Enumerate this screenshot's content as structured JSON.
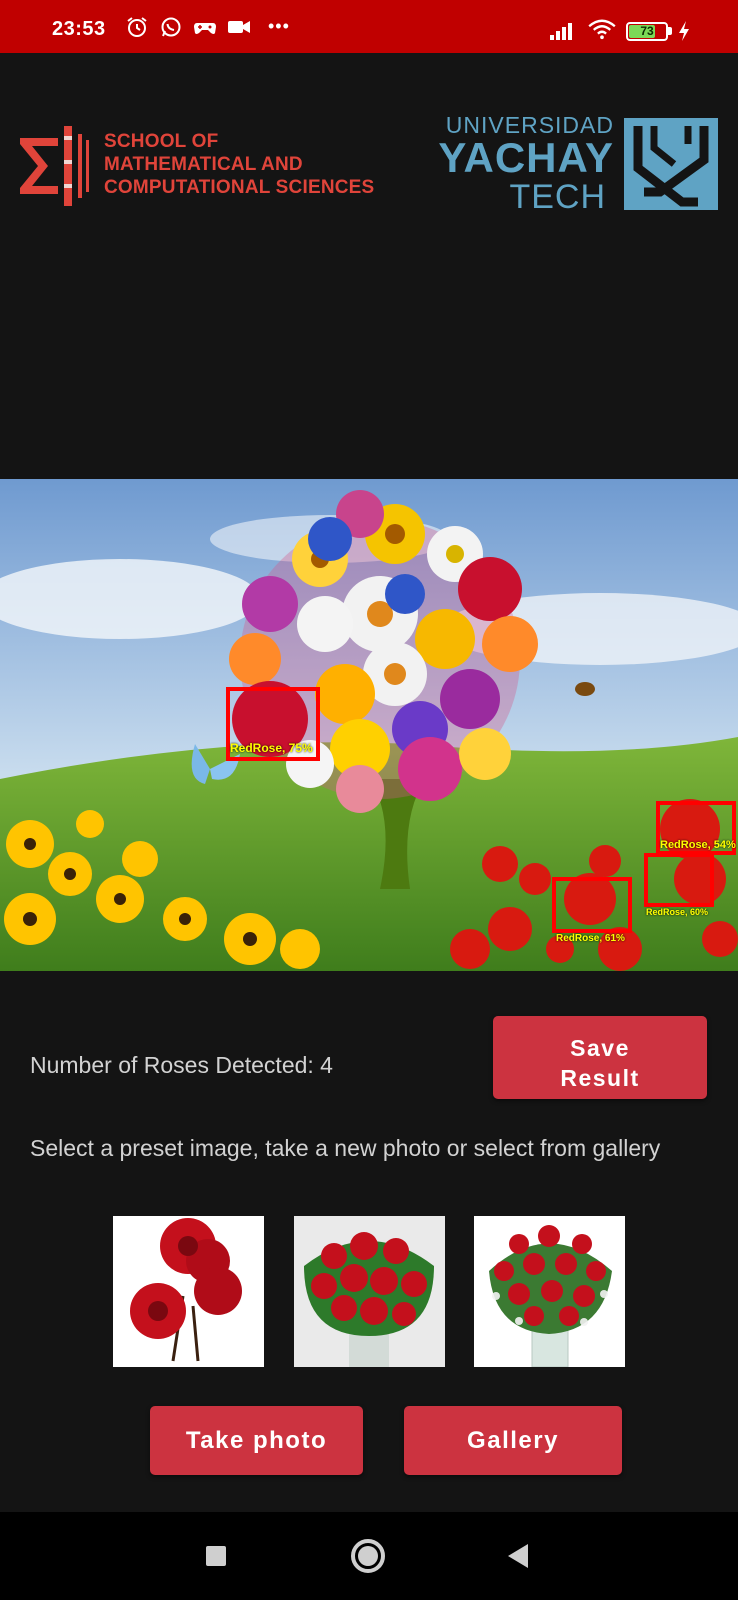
{
  "status_bar": {
    "time": "23:53",
    "icons": [
      "alarm-icon",
      "whatsapp-icon",
      "game-controller-icon",
      "video-camera-icon",
      "more-dots-icon",
      "signal-icon",
      "wifi-icon",
      "battery-icon",
      "charging-icon"
    ],
    "battery_level": "73",
    "battery_fraction": 0.73,
    "dots": "•••"
  },
  "header": {
    "school_logo": [
      "SCHOOL OF",
      "MATHEMATICAL AND",
      "COMPUTATIONAL SCIENCES"
    ],
    "university_logo": {
      "line1": "UNIVERSIDAD",
      "line2": "YACHAY",
      "line3": "TECH"
    }
  },
  "detections": [
    {
      "label": "RedRose, 75%"
    },
    {
      "label": "RedRose, 54%"
    },
    {
      "label": "RedRose, 60%"
    },
    {
      "label": "RedRose, 61%"
    }
  ],
  "results": {
    "count_text": "Number of Roses Detected: 4",
    "save_button_line1": "Save",
    "save_button_line2": "Result"
  },
  "instructions": "Select a preset image, take a new photo or select from gallery",
  "actions": {
    "take_photo": "Take photo",
    "gallery": "Gallery"
  },
  "colors": {
    "status_bar": "#c00000",
    "background": "#141414",
    "button": "#cc3340",
    "detection_box": "#ff0000",
    "detection_label": "#ffff00",
    "school_logo": "#e0443a",
    "university_logo": "#5fa3c4"
  }
}
